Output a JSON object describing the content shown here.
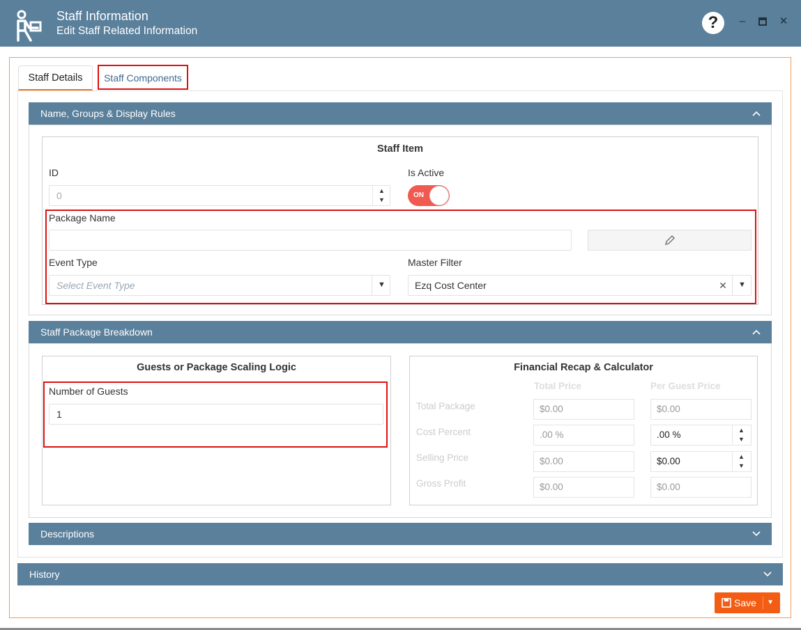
{
  "window": {
    "title": "Staff Information",
    "subtitle": "Edit Staff Related Information",
    "help_label": "?",
    "minimize_label": "–",
    "maximize_label": "□",
    "close_label": "✕"
  },
  "tabs": [
    {
      "label": "Staff Details",
      "active": true
    },
    {
      "label": "Staff Components",
      "active": false
    }
  ],
  "sections": {
    "name_groups": {
      "title": "Name, Groups & Display Rules",
      "panel_title": "Staff Item",
      "id_label": "ID",
      "id_value": "0",
      "is_active_label": "Is Active",
      "is_active_state": "ON",
      "package_name_label": "Package Name",
      "package_name_value": "",
      "event_type_label": "Event Type",
      "event_type_placeholder": "Select Event Type",
      "master_filter_label": "Master Filter",
      "master_filter_value": "Ezq Cost Center"
    },
    "breakdown": {
      "title": "Staff Package Breakdown",
      "scaling_title": "Guests or Package Scaling Logic",
      "guests_label": "Number of Guests",
      "guests_value": "1",
      "financial_title": "Financial Recap & Calculator",
      "col_total": "Total Price",
      "col_per_guest": "Per Guest Price",
      "rows": [
        {
          "label": "Total Package",
          "total": "$0.00",
          "per_guest": "$0.00"
        },
        {
          "label": "Cost Percent",
          "total": ".00 %",
          "per_guest": ".00 %"
        },
        {
          "label": "Selling Price",
          "total": "$0.00",
          "per_guest": "$0.00"
        },
        {
          "label": "Gross Profit",
          "total": "$0.00",
          "per_guest": "$0.00"
        }
      ]
    },
    "descriptions": {
      "title": "Descriptions"
    },
    "history": {
      "title": "History"
    }
  },
  "actions": {
    "save_label": "Save"
  },
  "colors": {
    "header": "#5a809c",
    "accent": "#f35d13",
    "highlight": "#e01010"
  }
}
